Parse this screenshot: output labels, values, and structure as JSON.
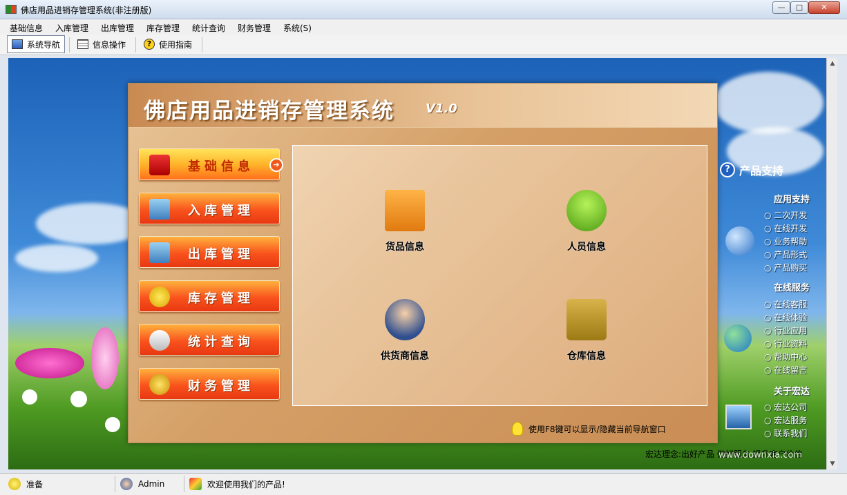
{
  "window": {
    "title": "佛店用品进销存管理系统(非注册版)"
  },
  "menu": [
    "基础信息",
    "入库管理",
    "出库管理",
    "库存管理",
    "统计查询",
    "财务管理",
    "系统(S)"
  ],
  "toolbar": [
    {
      "label": "系统导航",
      "icon": "monitor-icon",
      "active": true
    },
    {
      "label": "信息操作",
      "icon": "grid-icon",
      "active": false
    },
    {
      "label": "使用指南",
      "icon": "help-icon",
      "active": false
    }
  ],
  "panel": {
    "title": "佛店用品进销存管理系统",
    "version": "V1.0",
    "nav": [
      {
        "label": "基础信息",
        "icon": "alert-monitor-icon",
        "active": true
      },
      {
        "label": "入库管理",
        "icon": "inbound-icon",
        "active": false
      },
      {
        "label": "出库管理",
        "icon": "outbound-icon",
        "active": false
      },
      {
        "label": "库存管理",
        "icon": "star-icon",
        "active": false
      },
      {
        "label": "统计查询",
        "icon": "search-icon",
        "active": false
      },
      {
        "label": "财务管理",
        "icon": "coins-icon",
        "active": false
      }
    ],
    "tiles": [
      {
        "label": "货品信息",
        "icon": "boxes-icon"
      },
      {
        "label": "人员信息",
        "icon": "person-green-icon"
      },
      {
        "label": "供货商信息",
        "icon": "businessman-icon"
      },
      {
        "label": "仓库信息",
        "icon": "house-icon"
      }
    ],
    "hint": "使用F8键可以显示/隐藏当前导航窗口"
  },
  "support": {
    "title": "产品支持",
    "sections": [
      {
        "title": "应用支持",
        "links": [
          "二次开发",
          "在线开发",
          "业务帮助",
          "产品形式",
          "产品购买"
        ]
      },
      {
        "title": "在线服务",
        "links": [
          "在线客服",
          "在线体验",
          "行业应用",
          "行业资料",
          "帮助中心",
          "在线留言"
        ]
      },
      {
        "title": "关于宏达",
        "links": [
          "宏达公司",
          "宏达服务",
          "联系我们"
        ]
      }
    ],
    "motto": "宏达理念:出好产品 做好服务 提升客户价值"
  },
  "status": {
    "ready": "准备",
    "user": "Admin",
    "welcome": "欢迎使用我们的产品!"
  },
  "watermark": "www.downxia.com",
  "colors": {
    "accent": "#f9531d",
    "panel": "#d49f66",
    "sky": "#3f8ad8"
  }
}
